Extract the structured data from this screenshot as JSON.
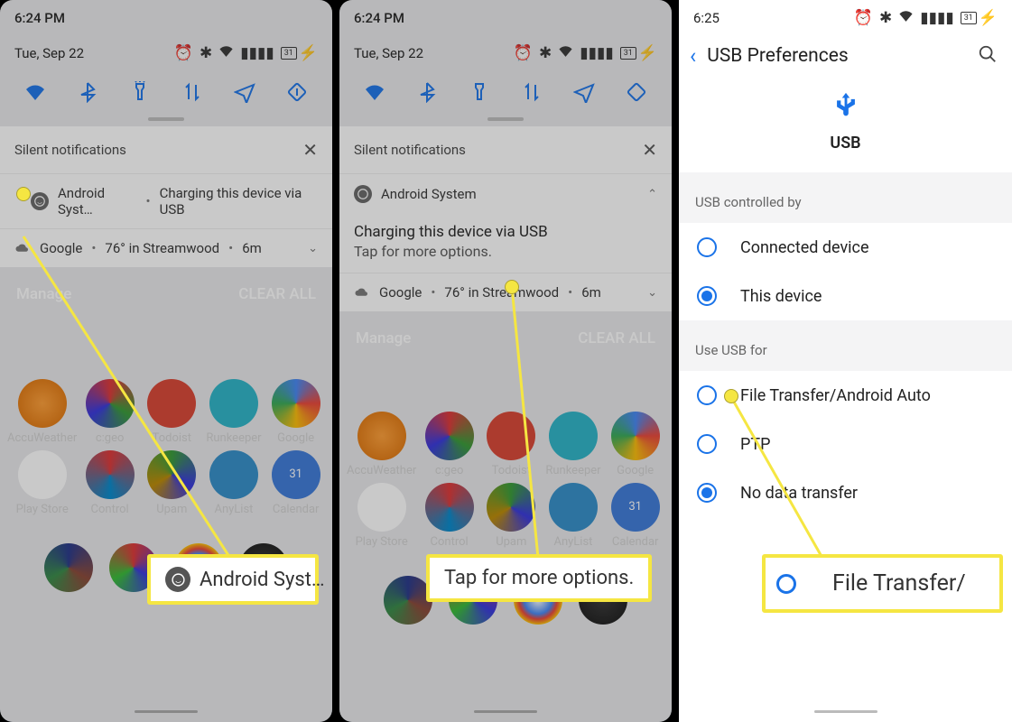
{
  "pane1": {
    "time": "6:24 PM",
    "date": "Tue, Sep 22",
    "battery": "31",
    "silent_header": "Silent notifications",
    "notif_sys": "Android Syst…",
    "notif_sys_sub": "Charging this device via USB",
    "weather_provider": "Google",
    "weather_text": "76° in Streamwood",
    "weather_time": "6m",
    "manage": "Manage",
    "clear": "CLEAR ALL",
    "apps": [
      "AccuWeather",
      "c:geo",
      "Todoist",
      "Runkeeper",
      "Google",
      "Play Store",
      "Control",
      "Upam",
      "AnyList",
      "Calendar"
    ],
    "callout": "Android Syst…"
  },
  "pane2": {
    "time": "6:24 PM",
    "date": "Tue, Sep 22",
    "battery": "31",
    "silent_header": "Silent notifications",
    "notif_sys": "Android System",
    "notif_title": "Charging this device via USB",
    "notif_sub": "Tap for more options.",
    "weather_provider": "Google",
    "weather_text": "76° in Streamwood",
    "weather_time": "6m",
    "manage": "Manage",
    "clear": "CLEAR ALL",
    "apps": [
      "AccuWeather",
      "c:geo",
      "Todoist",
      "Runkeeper",
      "Google",
      "Play Store",
      "Control",
      "Upam",
      "AnyList",
      "Calendar"
    ],
    "callout": "Tap for more options."
  },
  "pane3": {
    "time": "6:25",
    "battery": "31",
    "title": "USB Preferences",
    "usb_label": "USB",
    "section1": "USB controlled by",
    "opt_connected": "Connected device",
    "opt_this": "This device",
    "section2": "Use USB for",
    "opt_file": "File Transfer/Android Auto",
    "opt_ptp": "PTP",
    "opt_nodata": "No data transfer",
    "callout": "File Transfer/"
  }
}
